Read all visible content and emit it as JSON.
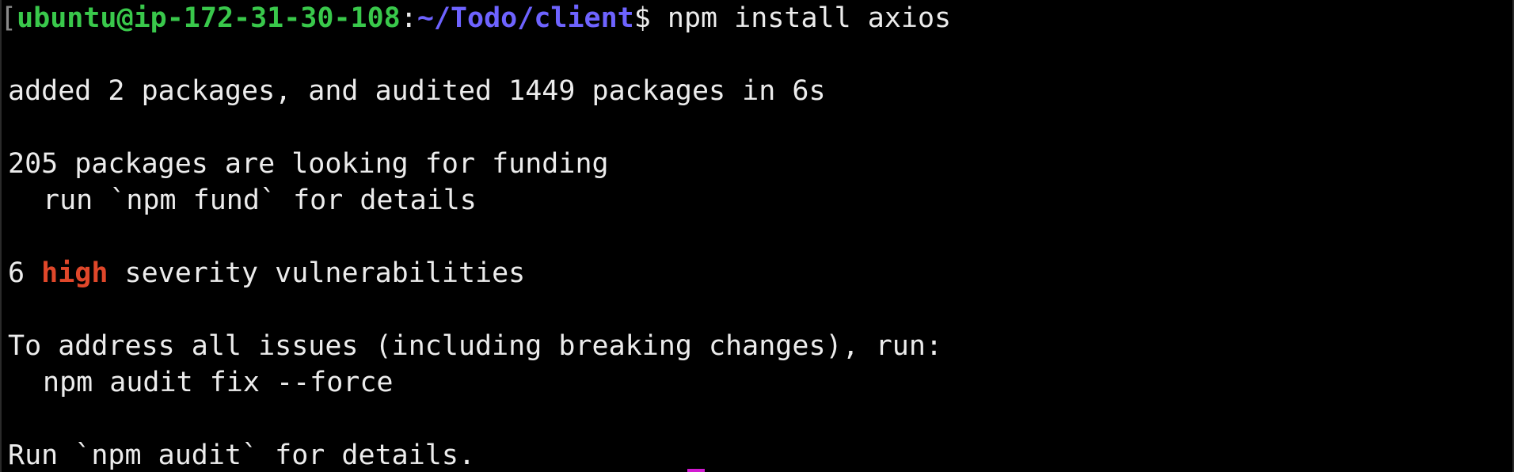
{
  "prompt": {
    "bracket": "[",
    "user_host": "ubuntu@ip-172-31-30-108",
    "colon": ":",
    "path": "~/Todo/client",
    "dollar": "$",
    "command": " npm install axios"
  },
  "output": {
    "added_line": "added 2 packages, and audited 1449 packages in 6s",
    "funding_line": "205 packages are looking for funding",
    "fund_hint_line": "run `npm fund` for details",
    "vuln_count": "6 ",
    "vuln_severity": "high",
    "vuln_suffix": " severity vulnerabilities",
    "address_line": "To address all issues (including breaking changes), run:",
    "fix_command_line": "npm audit fix --force",
    "audit_hint_line": "Run `npm audit` for details."
  },
  "colors": {
    "background": "#000000",
    "prompt_user": "#39c84b",
    "prompt_path": "#6e63ff",
    "severity_high": "#e0472a",
    "cursor": "#d11ad1"
  }
}
